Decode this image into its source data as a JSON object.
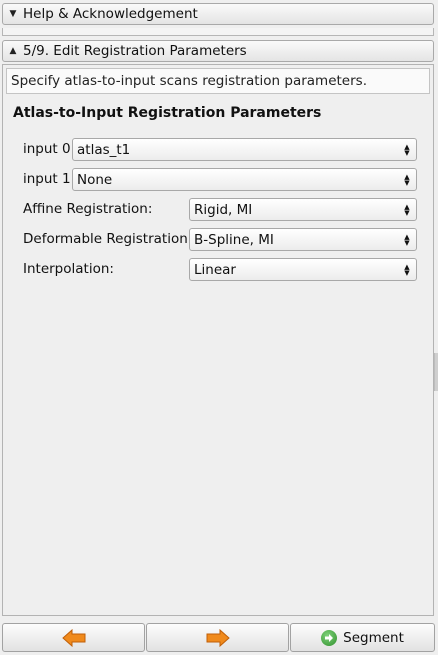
{
  "sections": {
    "help": {
      "arrow": "▼",
      "title": "Help & Acknowledgement"
    },
    "edit": {
      "arrow": "▲",
      "title": "5/9. Edit Registration Parameters"
    }
  },
  "description": "Specify atlas-to-input scans registration parameters.",
  "group": {
    "title": "Atlas-to-Input Registration Parameters",
    "rows": [
      {
        "label": "input 0",
        "value": "atlas_t1"
      },
      {
        "label": "input 1",
        "value": "None"
      },
      {
        "label": "Affine Registration:",
        "value": "Rigid, MI"
      },
      {
        "label": "Deformable Registration:",
        "value": "B-Spline, MI"
      },
      {
        "label": "Interpolation:",
        "value": "Linear"
      }
    ]
  },
  "footer": {
    "back_icon": "left-arrow-icon",
    "next_icon": "right-arrow-icon",
    "segment_label": "Segment",
    "segment_icon": "green-circle-arrow-icon",
    "arrow_color": "#f08a1c",
    "segment_color": "#3aa535"
  }
}
